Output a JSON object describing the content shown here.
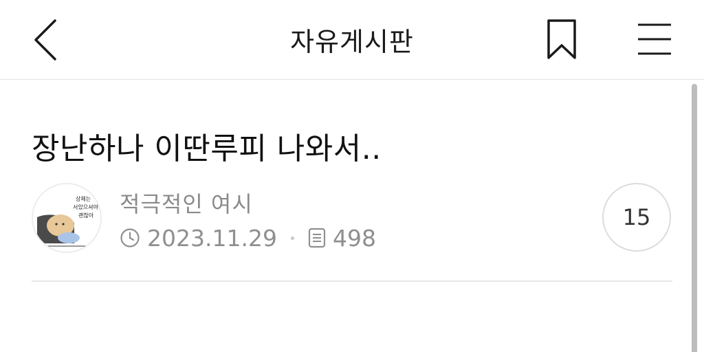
{
  "header": {
    "title": "자유게시판",
    "back_icon": "chevron-left-icon",
    "bookmark_icon": "bookmark-icon",
    "menu_icon": "hamburger-menu-icon"
  },
  "post": {
    "title": "장난하나 이딴루피 나와서..",
    "author": "적극적인 여시",
    "date": "2023.11.29",
    "views": "498",
    "comment_count": "15",
    "avatar_text": [
      "상체는",
      "서있으셔야",
      "괜찮아"
    ]
  }
}
